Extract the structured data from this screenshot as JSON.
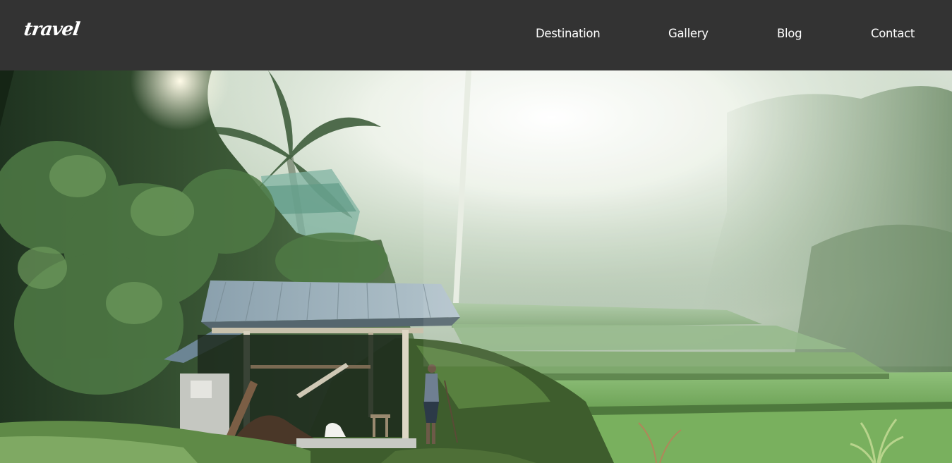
{
  "brand": {
    "logo_text": "travel"
  },
  "nav": {
    "items": [
      {
        "label": "Destination"
      },
      {
        "label": "Gallery"
      },
      {
        "label": "Blog"
      },
      {
        "label": "Contact"
      }
    ]
  },
  "colors": {
    "navbar_bg": "#333333",
    "nav_text": "#ffffff"
  },
  "hero": {
    "icon": "rice-terrace-landscape-photo"
  }
}
